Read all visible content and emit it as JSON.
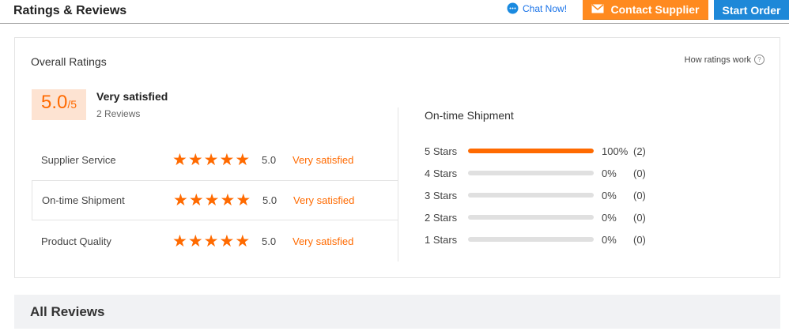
{
  "header": {
    "title": "Ratings & Reviews",
    "chat_label": "Chat Now!",
    "contact_label": "Contact Supplier",
    "order_label": "Start Order"
  },
  "overall": {
    "title": "Overall Ratings",
    "how_link": "How ratings work",
    "score": "5.0",
    "score_max": "/5",
    "satisfaction": "Very satisfied",
    "reviews": "2 Reviews"
  },
  "categories": [
    {
      "label": "Supplier Service",
      "stars": 5,
      "value": "5.0",
      "desc": "Very satisfied"
    },
    {
      "label": "On-time Shipment",
      "stars": 5,
      "value": "5.0",
      "desc": "Very satisfied"
    },
    {
      "label": "Product Quality",
      "stars": 5,
      "value": "5.0",
      "desc": "Very satisfied"
    }
  ],
  "shipment": {
    "title": "On-time Shipment",
    "rows": [
      {
        "label": "5  Stars",
        "percent": "100%",
        "count": "(2)",
        "fraction": 1.0
      },
      {
        "label": "4  Stars",
        "percent": "0%",
        "count": "(0)",
        "fraction": 0
      },
      {
        "label": "3  Stars",
        "percent": "0%",
        "count": "(0)",
        "fraction": 0
      },
      {
        "label": "2  Stars",
        "percent": "0%",
        "count": "(0)",
        "fraction": 0
      },
      {
        "label": "1  Stars",
        "percent": "0%",
        "count": "(0)",
        "fraction": 0
      }
    ]
  },
  "all_reviews": {
    "title": "All Reviews"
  },
  "colors": {
    "accent": "#ff6a00",
    "contact_button": "#ff8a1f",
    "order_button": "#1e88d8"
  },
  "icons": {
    "chat": "chat-bubble-icon",
    "mail": "mail-icon",
    "help": "question-circle-icon",
    "star": "star-icon"
  }
}
